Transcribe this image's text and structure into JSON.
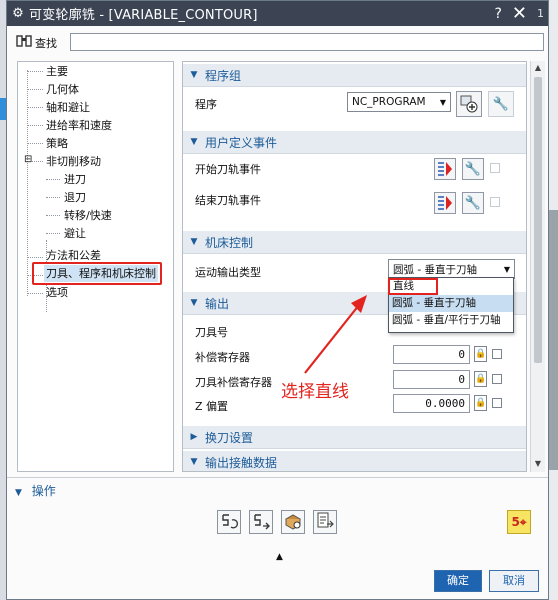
{
  "window": {
    "title": "可变轮廓铣 - [VARIABLE_CONTOUR]",
    "corner_index": "1"
  },
  "find": {
    "label": "查找",
    "value": ""
  },
  "tree": {
    "items": [
      {
        "label": "主要"
      },
      {
        "label": "几何体"
      },
      {
        "label": "轴和避让"
      },
      {
        "label": "进给率和速度"
      },
      {
        "label": "策略"
      },
      {
        "label": "非切削移动"
      },
      {
        "label": "进刀"
      },
      {
        "label": "退刀"
      },
      {
        "label": "转移/快速"
      },
      {
        "label": "避让"
      },
      {
        "label": "方法和公差"
      },
      {
        "label": "刀具、程序和机床控制"
      },
      {
        "label": "选项"
      }
    ],
    "expander": "⊟"
  },
  "panel": {
    "program_group": {
      "header": "程序组",
      "program_label": "程序",
      "program_value": "NC_PROGRAM"
    },
    "user_events": {
      "header": "用户定义事件",
      "start_label": "开始刀轨事件",
      "end_label": "结束刀轨事件"
    },
    "machine_control": {
      "header": "机床控制",
      "motion_label": "运动输出类型",
      "motion_value": "圆弧 - 垂直于刀轴",
      "options": [
        "直线",
        "圆弧 - 垂直于刀轴",
        "圆弧 - 垂直/平行于刀轴"
      ]
    },
    "output": {
      "header": "输出",
      "rows": [
        {
          "label": "刀具号",
          "value": ""
        },
        {
          "label": "补偿寄存器",
          "value": "0"
        },
        {
          "label": "刀具补偿寄存器",
          "value": "0"
        },
        {
          "label": "Z 偏置",
          "value": "0.0000"
        }
      ]
    },
    "tool_change": {
      "header": "换刀设置"
    },
    "contact_data": {
      "header": "输出接触数据"
    }
  },
  "annotation": {
    "text": "选择直线",
    "color": "#e3231e"
  },
  "operations": {
    "header": "操作"
  },
  "buttons": {
    "ok": "确定",
    "cancel": "取消"
  },
  "colors": {
    "titlebar": "#3c4454",
    "section_text": "#1d5c99",
    "ok_button": "#1f64b1"
  }
}
